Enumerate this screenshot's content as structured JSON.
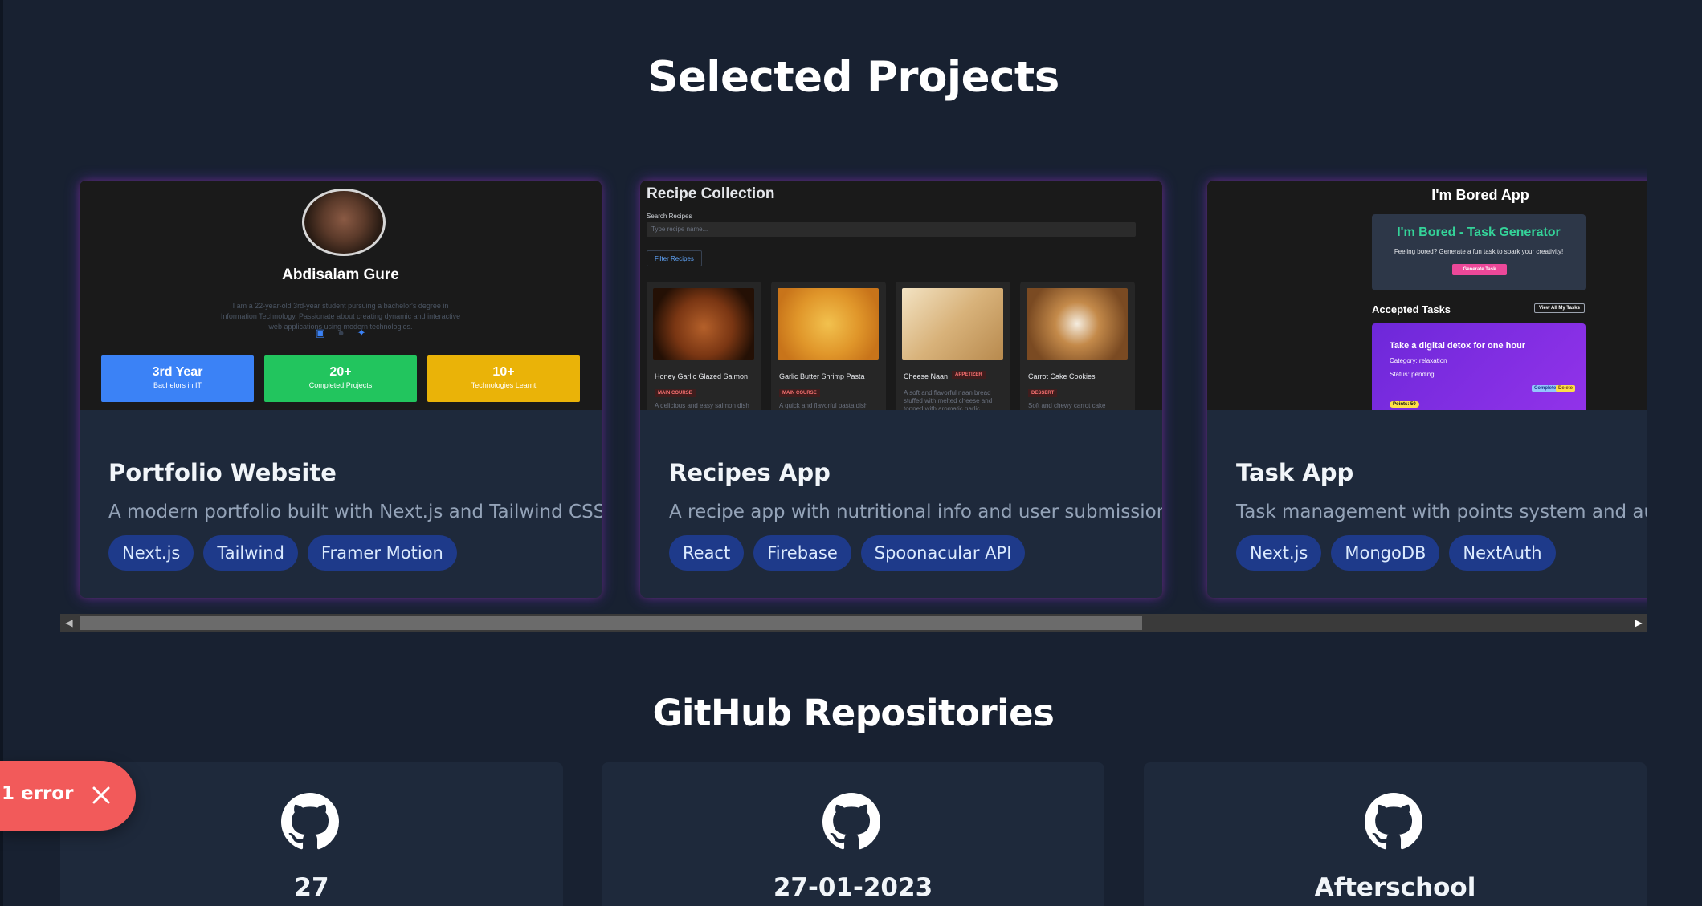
{
  "sections": {
    "projects_title": "Selected Projects",
    "repos_title": "GitHub Repositories"
  },
  "projects": [
    {
      "name": "Portfolio Website",
      "description": "A modern portfolio built with Next.js and Tailwind CSS.",
      "tags": [
        "Next.js",
        "Tailwind",
        "Framer Motion"
      ],
      "preview": {
        "name": "Abdisalam Gure",
        "bio": "I am a 22-year-old 3rd-year student pursuing a bachelor's degree in Information Technology. Passionate about creating dynamic and interactive web applications using modern technologies.",
        "stats": [
          {
            "value": "3rd Year",
            "label": "Bachelors in IT",
            "color": "#3b82f6"
          },
          {
            "value": "20+",
            "label": "Completed Projects",
            "color": "#22c55e"
          },
          {
            "value": "10+",
            "label": "Technologies Learnt",
            "color": "#eab308"
          }
        ]
      }
    },
    {
      "name": "Recipes App",
      "description": "A recipe app with nutritional info and user submissions.",
      "tags": [
        "React",
        "Firebase",
        "Spoonacular API"
      ],
      "preview": {
        "title": "Recipe Collection",
        "search_label": "Search Recipes",
        "search_placeholder": "Type recipe name...",
        "filter_label": "Filter Recipes",
        "items": [
          {
            "name": "Honey Garlic Glazed Salmon",
            "badge": "MAIN COURSE",
            "desc": "A delicious and easy salmon dish"
          },
          {
            "name": "Garlic Butter Shrimp Pasta",
            "badge": "MAIN COURSE",
            "desc": "A quick and flavorful pasta dish"
          },
          {
            "name": "Cheese Naan",
            "badge": "APPETIZER",
            "desc": "A soft and flavorful naan bread stuffed with melted cheese and topped with aromatic garlic"
          },
          {
            "name": "Carrot Cake Cookies",
            "badge": "DESSERT",
            "desc": "Soft and chewy carrot cake"
          }
        ]
      }
    },
    {
      "name": "Task App",
      "description": "Task management with points system and authentication.",
      "tags": [
        "Next.js",
        "MongoDB",
        "NextAuth"
      ],
      "preview": {
        "title": "I'm Bored App",
        "generator_title": "I'm Bored - Task Generator",
        "generator_text": "Feeling bored? Generate a fun task to spark your creativity!",
        "generate_label": "Generate Task",
        "accepted_label": "Accepted Tasks",
        "view_all_label": "View All My Tasks",
        "task": {
          "title": "Take a digital detox for one hour",
          "category": "Category: relaxation",
          "status": "Status: pending",
          "complete_label": "Complete",
          "delete_label": "Delete",
          "points": "Points: 50"
        }
      }
    }
  ],
  "repositories": [
    {
      "name": "27"
    },
    {
      "name": "27-01-2023"
    },
    {
      "name": "Afterschool"
    }
  ],
  "toast": {
    "label": "1 error"
  },
  "colors": {
    "background": "#182131",
    "card": "#1e293b",
    "tag_bg": "#1e3a8a",
    "error": "#f25a5a"
  }
}
